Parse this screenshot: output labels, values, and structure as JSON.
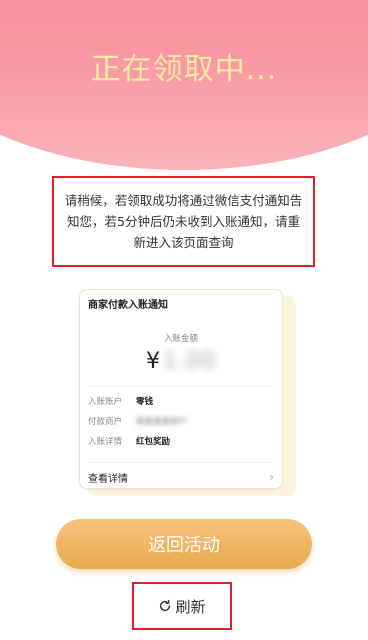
{
  "header": {
    "title": "正在领取中..."
  },
  "instruction": {
    "text": "请稍候，若领取成功将通过微信支付通知告知您，若5分钟后仍未收到入账通知，请重新进入该页面查询"
  },
  "card": {
    "title": "商家付款入账通知",
    "amount_label": "入账金额",
    "currency_symbol": "¥",
    "amount": "1.00",
    "rows": [
      {
        "label": "入账账户",
        "value": "零钱"
      },
      {
        "label": "付款商户",
        "value": "某某某某商户"
      },
      {
        "label": "入账详情",
        "value": "红包奖励"
      }
    ],
    "view_details": "查看详情"
  },
  "actions": {
    "return_label": "返回活动",
    "refresh_label": "刷新"
  },
  "colors": {
    "header_pink": "#f77e90",
    "title_gold": "#ffe7a6",
    "button_gold": "#e7aa4f",
    "highlight_red": "#e11f2a"
  }
}
